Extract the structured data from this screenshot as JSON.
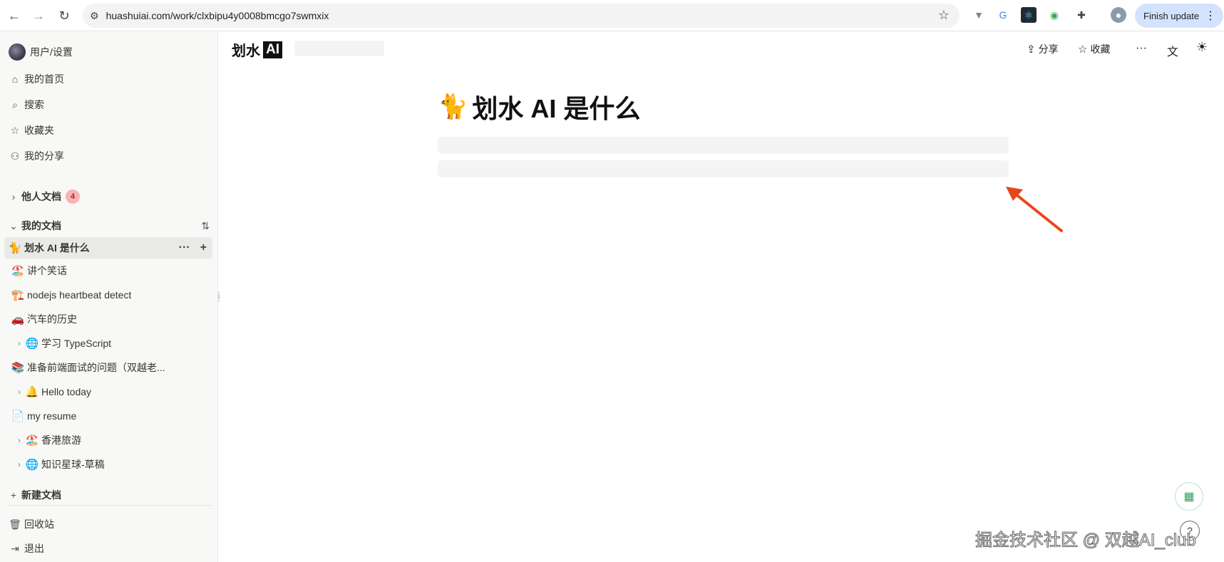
{
  "browser": {
    "url": "huashuiai.com/work/clxbipu4y0008bmcgo7swmxix",
    "finish_update": "Finish update",
    "colors": {
      "accent": "#d3e3fd"
    }
  },
  "sidebar": {
    "user": "用户/设置",
    "nav": [
      {
        "label": "我的首页",
        "icon": "home-icon"
      },
      {
        "label": "搜索",
        "icon": "search-icon"
      },
      {
        "label": "收藏夹",
        "icon": "star-icon"
      },
      {
        "label": "我的分享",
        "icon": "users-icon"
      }
    ],
    "others_docs": {
      "label": "他人文档",
      "count": "4"
    },
    "my_docs_label": "我的文档",
    "docs": [
      {
        "emoji": "🐈",
        "title": "划水 AI 是什么",
        "active": true,
        "expandable": false
      },
      {
        "emoji": "🏖️",
        "title": "讲个笑话",
        "expandable": false
      },
      {
        "emoji": "🏗️",
        "title": "nodejs heartbeat detect",
        "expandable": false
      },
      {
        "emoji": "🚗",
        "title": "汽车的历史",
        "expandable": false
      },
      {
        "emoji": "🌐",
        "title": "学习 TypeScript",
        "expandable": true
      },
      {
        "emoji": "📚",
        "title": "准备前端面试的问题（双越老...",
        "expandable": false
      },
      {
        "emoji": "🔔",
        "title": "Hello today",
        "expandable": true
      },
      {
        "emoji": "📄",
        "title": "my resume",
        "expandable": false
      },
      {
        "emoji": "🏖️",
        "title": "香港旅游",
        "expandable": true
      },
      {
        "emoji": "🌐",
        "title": "知识星球-草稿",
        "expandable": true
      }
    ],
    "new_doc": "新建文档",
    "trash": "回收站",
    "logout": "退出"
  },
  "topbar": {
    "logo_text": "划水",
    "logo_ai": "AI",
    "share": "分享",
    "favorite": "收藏"
  },
  "document": {
    "emoji": "🐈",
    "title": "划水 AI 是什么"
  },
  "watermark": "掘金技术社区 @ 双越AI_club",
  "arrow_color": "#e8461e"
}
